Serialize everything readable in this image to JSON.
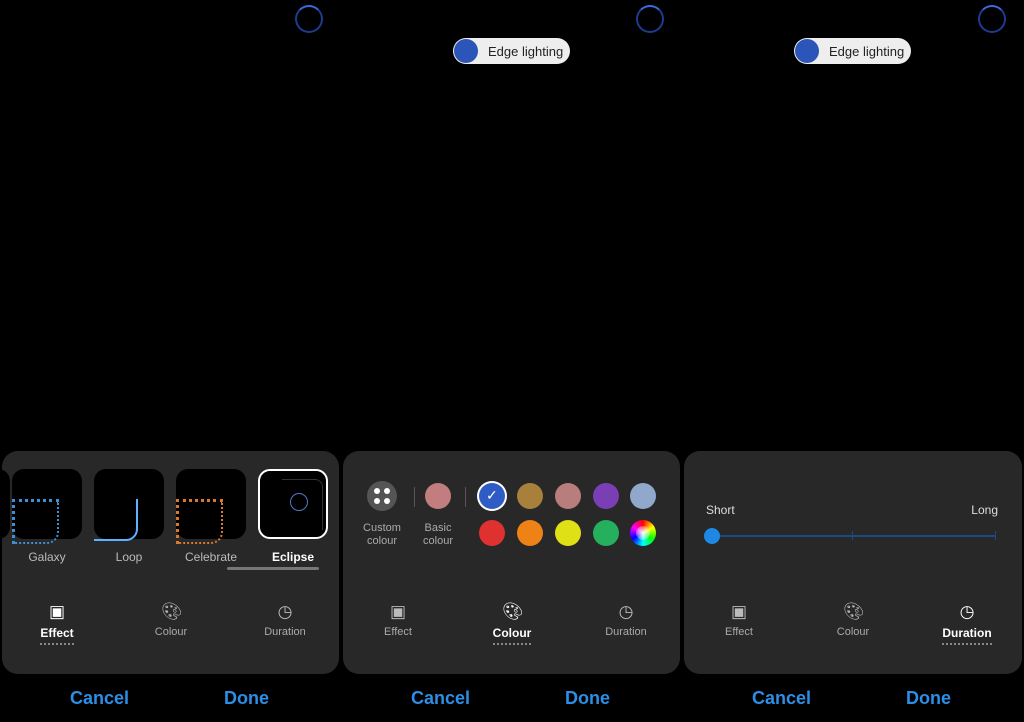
{
  "edge_toggle": {
    "label": "Edge lighting"
  },
  "tabs": {
    "effect": "Effect",
    "colour": "Colour",
    "duration": "Duration"
  },
  "buttons": {
    "cancel": "Cancel",
    "done": "Done"
  },
  "effects": [
    "Galaxy",
    "Loop",
    "Celebrate",
    "Eclipse"
  ],
  "colour_panel": {
    "custom_line1": "Custom",
    "custom_line2": "colour",
    "basic_line1": "Basic",
    "basic_line2": "colour",
    "basic_colour": "#c27e7e",
    "row1": [
      "#2f5bc4",
      "#a8803c",
      "#b87e7e",
      "#7b3fb5",
      "#8fa8cc"
    ],
    "row2": [
      "#e03131",
      "#ef8216",
      "#e0e016",
      "#25b05e"
    ],
    "selected_index": 0
  },
  "duration_panel": {
    "short": "Short",
    "long": "Long",
    "value": 0.0
  },
  "colors": {
    "accent": "#2c8ee6",
    "sheet": "#282828"
  }
}
